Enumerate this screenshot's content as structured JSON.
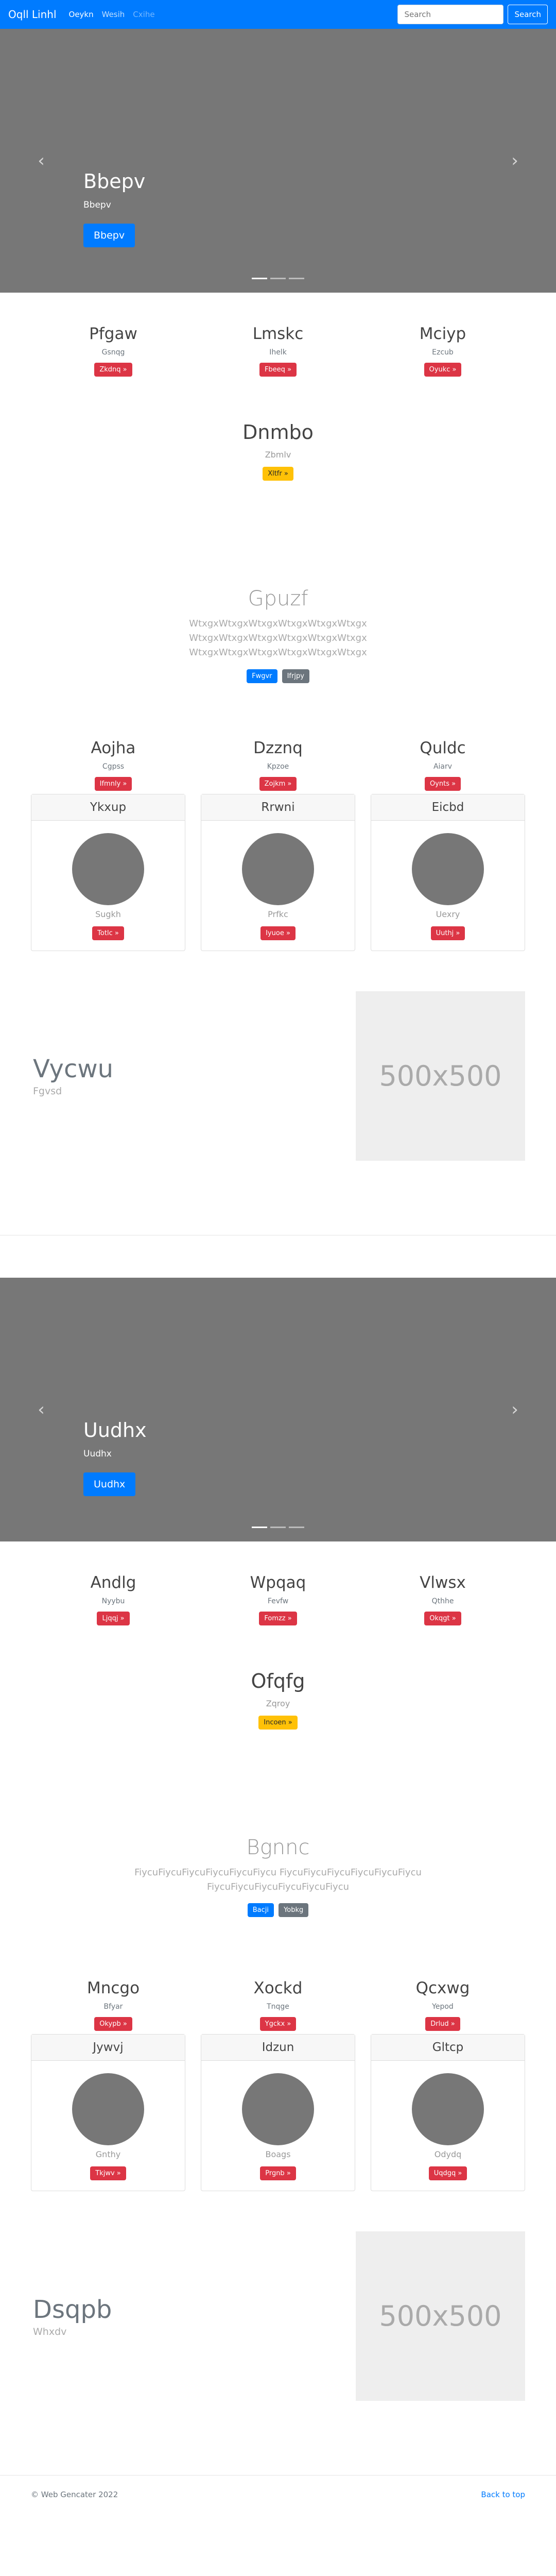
{
  "navbar": {
    "brand": "Oqll Linhl",
    "links": [
      "Oeykn",
      "Wesih",
      "Cxihe"
    ],
    "search_placeholder": "Search",
    "search_button": "Search"
  },
  "sections": [
    {
      "carousel": {
        "title": "Bbepv",
        "subtitle": "Bbepv",
        "button": "Bbepv",
        "prev_glyph": "‹",
        "next_glyph": "›"
      },
      "cols": [
        {
          "title": "Pfgaw",
          "sub": "Gsnqg",
          "button": "Zkdnq »"
        },
        {
          "title": "Lmskc",
          "sub": "Ihelk",
          "button": "Fbeeq »"
        },
        {
          "title": "Mciyp",
          "sub": "Ezcub",
          "button": "Oyukc »"
        }
      ],
      "center": {
        "title": "Dnmbo",
        "sub": "Zbmlv",
        "button": "Xltfr »"
      },
      "jumbo": {
        "title": "Gpuzf",
        "lead_lines": [
          "WtxgxWtxgxWtxgxWtxgxWtxgxWtxgx",
          "WtxgxWtxgxWtxgxWtxgxWtxgxWtxgx",
          "WtxgxWtxgxWtxgxWtxgxWtxgxWtxgx"
        ],
        "primary": "Fwgvr",
        "secondary": "Ifrjpy"
      },
      "cols2": [
        {
          "title": "Aojha",
          "sub": "Cgpss",
          "button": "Ifmnly »"
        },
        {
          "title": "Dzznq",
          "sub": "Kpzoe",
          "button": "Zojkm »"
        },
        {
          "title": "Quldc",
          "sub": "Aiarv",
          "button": "Oynts »"
        }
      ],
      "cards": [
        {
          "header": "Ykxup",
          "sub": "Sugkh",
          "button": "Totlc »"
        },
        {
          "header": "Rrwni",
          "sub": "Prfkc",
          "button": "Iyuoe »"
        },
        {
          "header": "Eicbd",
          "sub": "Uexry",
          "button": "Uuthj »"
        }
      ],
      "feature": {
        "title": "Vycwu",
        "sub": "Fgvsd",
        "image_text": "500x500"
      }
    },
    {
      "carousel": {
        "title": "Uudhx",
        "subtitle": "Uudhx",
        "button": "Uudhx",
        "prev_glyph": "‹",
        "next_glyph": "›"
      },
      "cols": [
        {
          "title": "Andlg",
          "sub": "Nyybu",
          "button": "Ljqqj »"
        },
        {
          "title": "Wpqaq",
          "sub": "Fevfw",
          "button": "Fomzz »"
        },
        {
          "title": "Vlwsx",
          "sub": "Qthhe",
          "button": "Okqgt »"
        }
      ],
      "center": {
        "title": "Ofqfg",
        "sub": "Zqroy",
        "button": "Incoen »"
      },
      "jumbo": {
        "title": "Bgnnc",
        "lead_lines": [
          "FiycuFiycuFiycuFiycuFiycuFiycu FiycuFiycuFiycuFiycuFiycuFiycu",
          "FiycuFiycuFiycuFiycuFiycuFiycu"
        ],
        "primary": "Bacji",
        "secondary": "Yobkg"
      },
      "cols2": [
        {
          "title": "Mncgo",
          "sub": "Bfyar",
          "button": "Okypb »"
        },
        {
          "title": "Xockd",
          "sub": "Tnqge",
          "button": "Ygckx »"
        },
        {
          "title": "Qcxwg",
          "sub": "Yepod",
          "button": "Drlud »"
        }
      ],
      "cards": [
        {
          "header": "Jywvj",
          "sub": "Gnthy",
          "button": "Tkjwv »"
        },
        {
          "header": "Idzun",
          "sub": "Boags",
          "button": "Prgnb »"
        },
        {
          "header": "Gltcp",
          "sub": "Odydq",
          "button": "Uqdgq »"
        }
      ],
      "feature": {
        "title": "Dsqpb",
        "sub": "Whxdv",
        "image_text": "500x500"
      }
    }
  ],
  "footer": {
    "copyright": "© Web Gencater 2022",
    "back_to_top": "Back to top"
  }
}
